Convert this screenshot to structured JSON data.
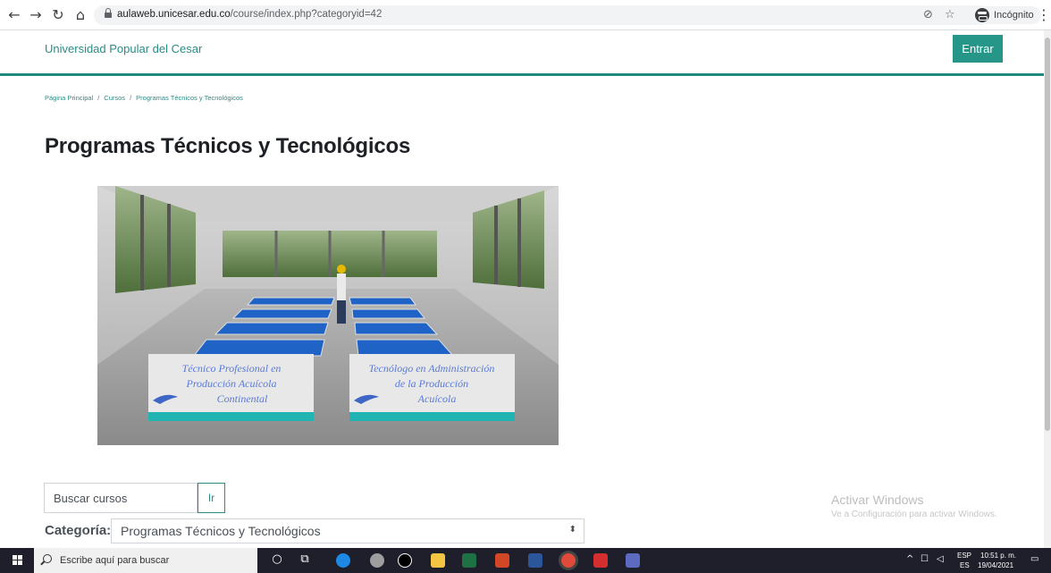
{
  "browser": {
    "url_host": "aulaweb.unicesar.edu.co",
    "url_path": "/course/index.php?categoryid=42",
    "incognito_label": "Incógnito"
  },
  "header": {
    "site_name": "Universidad Popular del Cesar",
    "login_label": "Entrar"
  },
  "breadcrumb": [
    "Página Principal",
    "Cursos",
    "Programas Técnicos y Tecnológicos"
  ],
  "page_title": "Programas Técnicos y Tecnológicos",
  "hero_image": {
    "sign_left": [
      "Técnico Profesional en",
      "Producción Acuícola",
      "Continental"
    ],
    "sign_right": [
      "Tecnólogo en Administración",
      "de la Producción",
      "Acuícola"
    ]
  },
  "search": {
    "placeholder": "Buscar cursos",
    "go_label": "Ir"
  },
  "category": {
    "label": "Categoría:",
    "selected": "Programas Técnicos y Tecnológicos"
  },
  "watermark": {
    "title": "Activar Windows",
    "subtitle": "Ve a Configuración para activar Windows."
  },
  "taskbar": {
    "search_placeholder": "Escribe aquí para buscar",
    "lang_top": "ESP",
    "lang_bottom": "ES",
    "time": "10:51 p. m.",
    "date": "19/04/2021"
  },
  "colors": {
    "brand": "#259688",
    "link": "#2a8c86"
  }
}
